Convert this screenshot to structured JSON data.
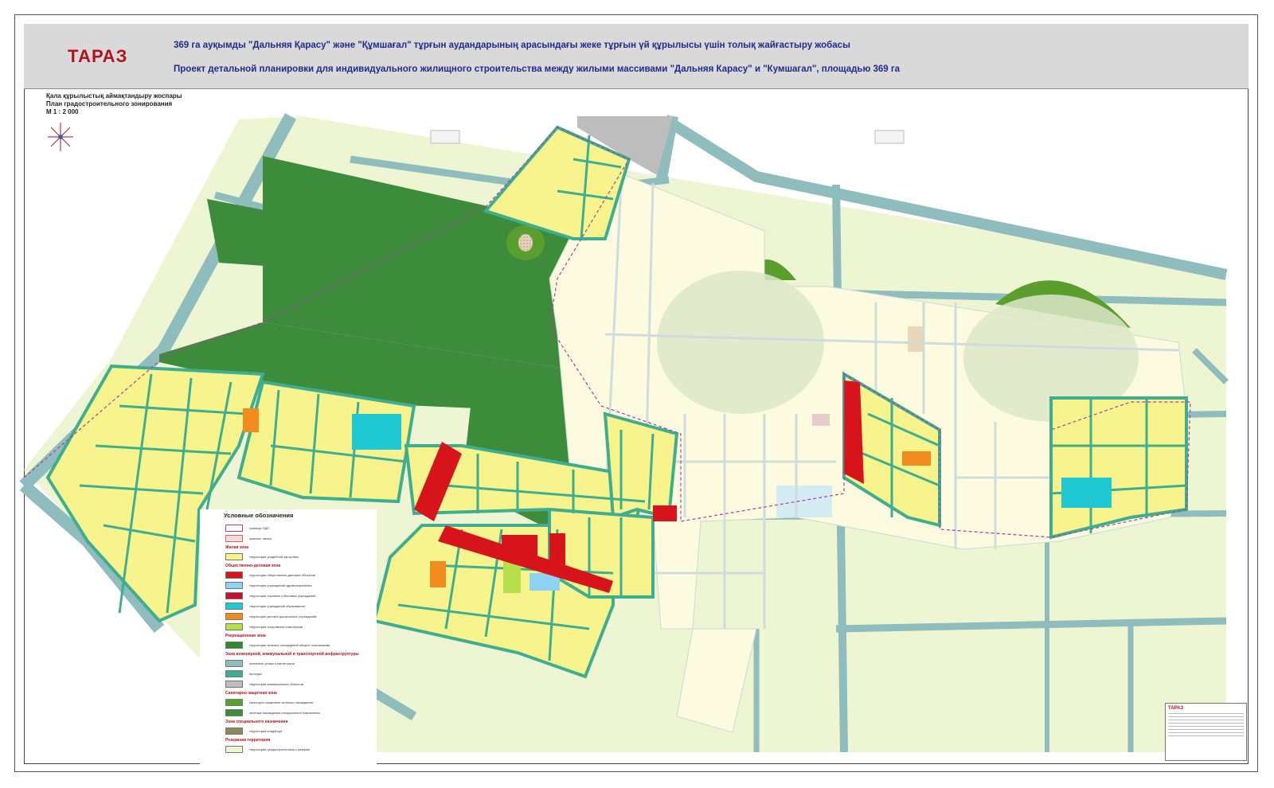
{
  "header": {
    "city": "ТАРАЗ",
    "title_kz": "369 га ауқымды \"Дальняя Қарасу\" және \"Құмшағал\" тұрғын аудандарының арасындағы жеке тұрғын үй құрылысы үшін толық жайғастыру жобасы",
    "title_ru": "Проект  детальной планировки для индивидуального жилищного строительства между жилыми массивами \"Дальняя Карасу\" и \"Кумшагал\", площадью 369 га"
  },
  "subtitle": {
    "kz": "Қала құрылыстық аймақтандыру жоспары",
    "ru": "План градостроительного зонирования",
    "scale": "М 1 : 2 000"
  },
  "legend": {
    "title": "Условные обозначения",
    "sections": [
      {
        "heading": "",
        "items": [
          {
            "color": "#ffffff",
            "label": "границы ПДП"
          },
          {
            "color": "#f6dada",
            "label": "красные линии"
          }
        ]
      },
      {
        "heading": "Жилая зона",
        "items": [
          {
            "color": "#f6f38c",
            "label": "территории усадебной застройки"
          }
        ]
      },
      {
        "heading": "Общественно-деловая зона",
        "items": [
          {
            "color": "#d7141c",
            "label": "территории общественно-деловых объектов"
          },
          {
            "color": "#8fd3f2",
            "label": "территории учреждений здравоохранения"
          },
          {
            "color": "#c8102e",
            "label": "территории торговых и бытовых учреждений"
          },
          {
            "color": "#1fc8d2",
            "label": "территории учреждений образования"
          },
          {
            "color": "#f28c1e",
            "label": "территории детских дошкольных учреждений"
          },
          {
            "color": "#b5e04a",
            "label": "территории спортивных комплексов"
          }
        ]
      },
      {
        "heading": "Рекреационная зона",
        "items": [
          {
            "color": "#2e8b2e",
            "label": "территории зеленых насаждений общего пользования"
          }
        ]
      },
      {
        "heading": "Зона инженерной, коммунальной и транспортной инфраструктуры",
        "items": [
          {
            "color": "#8fbcbc",
            "label": "основные улицы и магистрали"
          },
          {
            "color": "#3fae8f",
            "label": "проезды"
          },
          {
            "color": "#bdbdbd",
            "label": "территории коммунальных объектов"
          }
        ]
      },
      {
        "heading": "Санитарно-защитная зона",
        "items": [
          {
            "color": "#5aa02c",
            "label": "санитарно-защитные зеленые насаждения"
          },
          {
            "color": "#3c8c3c",
            "label": "зеленые насаждения специального назначения"
          }
        ]
      },
      {
        "heading": "Зона специального назначения",
        "items": [
          {
            "color": "#8a8a5a",
            "label": "территория кладбища"
          }
        ]
      },
      {
        "heading": "Резервная территория",
        "items": [
          {
            "color": "#eef5d2",
            "label": "территории градостроительного резерва"
          }
        ]
      }
    ]
  },
  "stamp": {
    "city": "ТАРАЗ"
  },
  "colors": {
    "residential": "#f7f48e",
    "road": "#8fbcbc",
    "driveway": "#3fae8f",
    "forest": "#3c8c3c",
    "reserve": "#eef5d2",
    "existing": "#fcfbe0"
  }
}
